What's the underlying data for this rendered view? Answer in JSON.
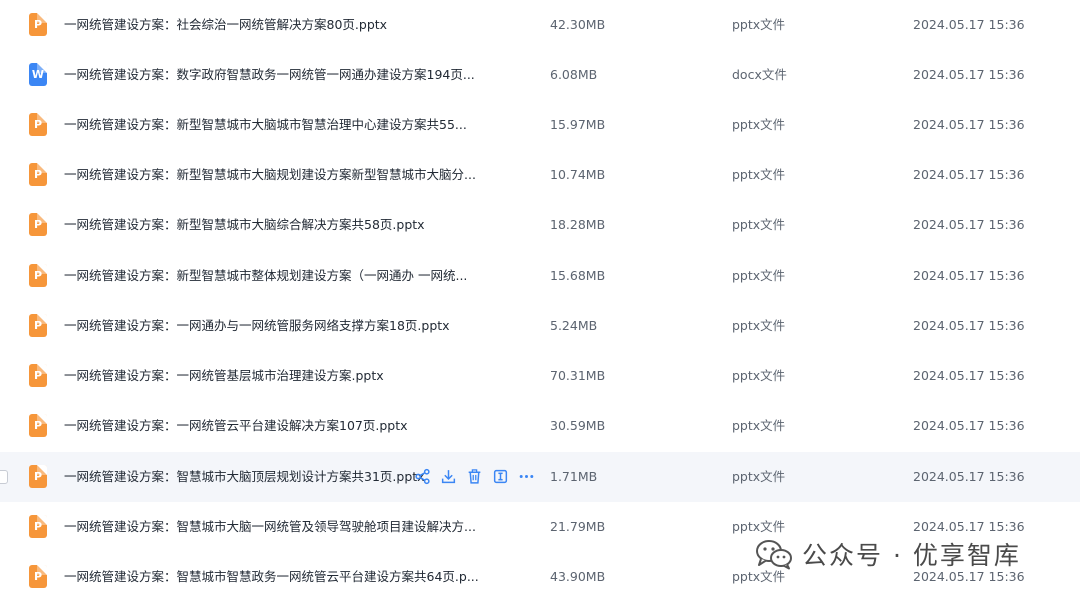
{
  "files": [
    {
      "icon": "pptx-file-icon",
      "type_key": "pptx",
      "glyph": "P",
      "name": "一网统管建设方案：社会综治一网统管解决方案80页.pptx",
      "size": "42.30MB",
      "kind": "pptx文件",
      "date": "2024.05.17 15:36"
    },
    {
      "icon": "docx-file-icon",
      "type_key": "docx",
      "glyph": "W",
      "name": "一网统管建设方案：数字政府智慧政务一网统管一网通办建设方案194页...",
      "size": "6.08MB",
      "kind": "docx文件",
      "date": "2024.05.17 15:36"
    },
    {
      "icon": "pptx-file-icon",
      "type_key": "pptx",
      "glyph": "P",
      "name": "一网统管建设方案：新型智慧城市大脑城市智慧治理中心建设方案共55...",
      "size": "15.97MB",
      "kind": "pptx文件",
      "date": "2024.05.17 15:36"
    },
    {
      "icon": "pptx-file-icon",
      "type_key": "pptx",
      "glyph": "P",
      "name": "一网统管建设方案：新型智慧城市大脑规划建设方案新型智慧城市大脑分...",
      "size": "10.74MB",
      "kind": "pptx文件",
      "date": "2024.05.17 15:36"
    },
    {
      "icon": "pptx-file-icon",
      "type_key": "pptx",
      "glyph": "P",
      "name": "一网统管建设方案：新型智慧城市大脑综合解决方案共58页.pptx",
      "size": "18.28MB",
      "kind": "pptx文件",
      "date": "2024.05.17 15:36"
    },
    {
      "icon": "pptx-file-icon",
      "type_key": "pptx",
      "glyph": "P",
      "name": "一网统管建设方案：新型智慧城市整体规划建设方案（一网通办 一网统...",
      "size": "15.68MB",
      "kind": "pptx文件",
      "date": "2024.05.17 15:36"
    },
    {
      "icon": "pptx-file-icon",
      "type_key": "pptx",
      "glyph": "P",
      "name": "一网统管建设方案：一网通办与一网统管服务网络支撑方案18页.pptx",
      "size": "5.24MB",
      "kind": "pptx文件",
      "date": "2024.05.17 15:36"
    },
    {
      "icon": "pptx-file-icon",
      "type_key": "pptx",
      "glyph": "P",
      "name": "一网统管建设方案：一网统管基层城市治理建设方案.pptx",
      "size": "70.31MB",
      "kind": "pptx文件",
      "date": "2024.05.17 15:36"
    },
    {
      "icon": "pptx-file-icon",
      "type_key": "pptx",
      "glyph": "P",
      "name": "一网统管建设方案：一网统管云平台建设解决方案107页.pptx",
      "size": "30.59MB",
      "kind": "pptx文件",
      "date": "2024.05.17 15:36"
    },
    {
      "icon": "pptx-file-icon",
      "type_key": "pptx",
      "glyph": "P",
      "name": "一网统管建设方案：智慧城市大脑顶层规划设计方案共31页.pptx",
      "size": "1.71MB",
      "kind": "pptx文件",
      "date": "2024.05.17 15:36",
      "hover": true
    },
    {
      "icon": "pptx-file-icon",
      "type_key": "pptx",
      "glyph": "P",
      "name": "一网统管建设方案：智慧城市大脑一网统管及领导驾驶舱项目建设解决方...",
      "size": "21.79MB",
      "kind": "pptx文件",
      "date": "2024.05.17 15:36"
    },
    {
      "icon": "pptx-file-icon",
      "type_key": "pptx",
      "glyph": "P",
      "name": "一网统管建设方案：智慧城市智慧政务一网统管云平台建设方案共64页.p...",
      "size": "43.90MB",
      "kind": "pptx文件",
      "date": "2024.05.17 15:36"
    }
  ],
  "row_actions": [
    "share-icon",
    "download-icon",
    "delete-icon",
    "rename-icon",
    "more-icon"
  ],
  "colors": {
    "pptx": "#f6963a",
    "docx": "#3b86f4",
    "action_blue": "#3b86f4",
    "hover_row": "#f4f6fa"
  },
  "watermark": {
    "icon": "wechat-icon",
    "text": "公众号 · 优享智库"
  }
}
